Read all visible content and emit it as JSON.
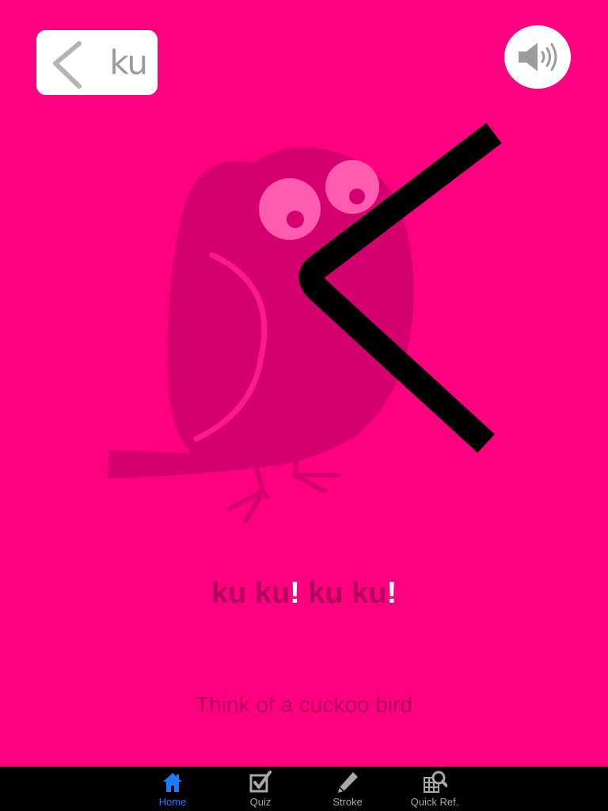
{
  "header": {
    "kana": "く",
    "romaji": "ku"
  },
  "sound_button": {
    "icon": "speaker-icon"
  },
  "illustration": {
    "subject": "cuckoo bird",
    "character": "く"
  },
  "phrase": {
    "part1": "ku ku",
    "bang1": "!",
    "part2": " ku ku",
    "bang2": "!"
  },
  "hint": "Think of a cuckoo bird",
  "tabs": [
    {
      "label": "Home",
      "icon": "home-icon",
      "active": true
    },
    {
      "label": "Quiz",
      "icon": "checkbox-icon",
      "active": false
    },
    {
      "label": "Stroke",
      "icon": "pencil-icon",
      "active": false
    },
    {
      "label": "Quick Ref.",
      "icon": "grid-search-icon",
      "active": false
    }
  ],
  "colors": {
    "background": "#ff0080",
    "bird": "#d4006f",
    "eye": "#ff5cb0",
    "phrase_text": "#b0005a",
    "active_tab": "#1a7bff",
    "inactive_tab": "#a8a8a8"
  }
}
